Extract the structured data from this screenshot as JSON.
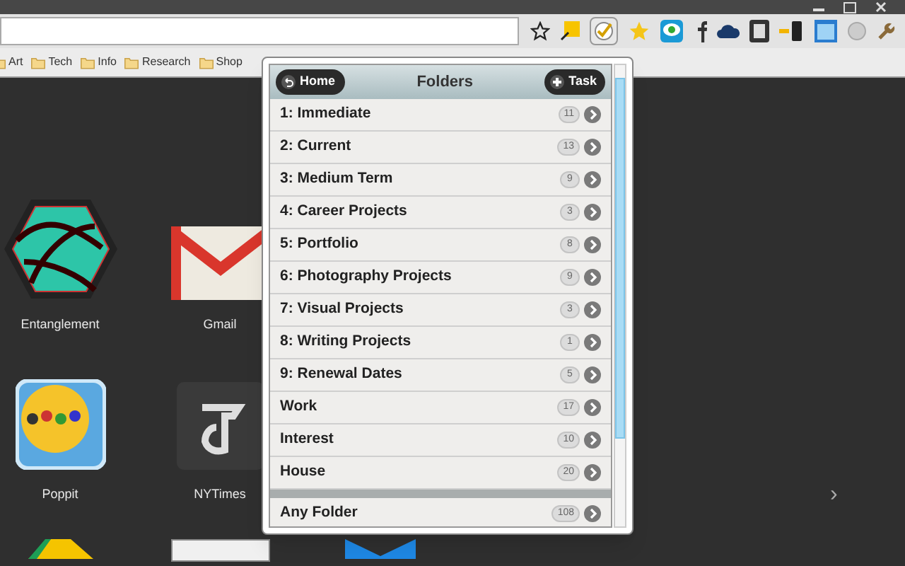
{
  "bookmarks": [
    "Art",
    "Tech",
    "Info",
    "Research",
    "Shop"
  ],
  "apps": [
    {
      "kind": "entanglement",
      "label": "Entanglement"
    },
    {
      "kind": "gmail",
      "label": "Gmail"
    },
    {
      "kind": "poppit",
      "label": "Poppit"
    },
    {
      "kind": "nytimes",
      "label": "NYTimes"
    },
    {
      "kind": "drive"
    },
    {
      "kind": "screenshot"
    },
    {
      "kind": "book"
    }
  ],
  "next_arrow": "›",
  "popup": {
    "title": "Folders",
    "home_button": "Home",
    "task_button": "Task",
    "folders": [
      {
        "name": "1: Immediate",
        "count": "11"
      },
      {
        "name": "2: Current",
        "count": "13"
      },
      {
        "name": "3: Medium Term",
        "count": "9"
      },
      {
        "name": "4: Career Projects",
        "count": "3"
      },
      {
        "name": "5: Portfolio",
        "count": "8"
      },
      {
        "name": "6: Photography Projects",
        "count": "9"
      },
      {
        "name": "7: Visual Projects",
        "count": "3"
      },
      {
        "name": "8: Writing Projects",
        "count": "1"
      },
      {
        "name": "9: Renewal Dates",
        "count": "5"
      },
      {
        "name": "Work",
        "count": "17"
      },
      {
        "name": "Interest",
        "count": "10"
      },
      {
        "name": "House",
        "count": "20"
      },
      {
        "kind": "divider"
      },
      {
        "name": "Any Folder",
        "count": "108"
      }
    ]
  }
}
